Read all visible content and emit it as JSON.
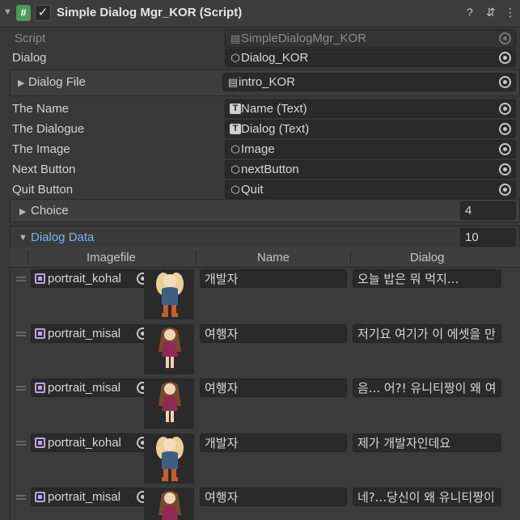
{
  "header": {
    "script_glyph": "#",
    "check_glyph": "✓",
    "title": "Simple Dialog Mgr_KOR (Script)",
    "help_glyph": "?",
    "settings_glyph": "⇵",
    "more_glyph": "⋮"
  },
  "script_row": {
    "label": "Script",
    "value": "SimpleDialogMgr_KOR",
    "icon": "script-file-icon"
  },
  "fields": [
    {
      "label": "Dialog",
      "value": "Dialog_KOR",
      "icon": "cube-icon",
      "glyph": "⬡"
    },
    {
      "label": "Dialog File",
      "value": "intro_KOR",
      "icon": "text-asset-icon",
      "glyph": "▤"
    },
    {
      "label": "The Name",
      "value": "Name (Text)",
      "icon": "text-component-icon",
      "glyph": "T"
    },
    {
      "label": "The Dialogue",
      "value": "Dialog (Text)",
      "icon": "text-component-icon",
      "glyph": "T"
    },
    {
      "label": "The Image",
      "value": "Image",
      "icon": "cube-icon",
      "glyph": "⬡"
    },
    {
      "label": "Next Button",
      "value": "nextButton",
      "icon": "cube-icon",
      "glyph": "⬡"
    },
    {
      "label": "Quit Button",
      "value": "Quit",
      "icon": "cube-icon",
      "glyph": "⬡"
    }
  ],
  "choice": {
    "label": "Choice",
    "count": "4"
  },
  "dialog_data": {
    "label": "Dialog Data",
    "count": "10",
    "columns": [
      "Imagefile",
      "Name",
      "Dialog"
    ],
    "rows": [
      {
        "image": "portrait_kohal",
        "name": "개발자",
        "dialog": "오늘 밥은 뭐 먹지...",
        "portrait": "kohal"
      },
      {
        "image": "portrait_misal",
        "name": "여행자",
        "dialog": "저기요 여기가 이 에셋을 만",
        "portrait": "misal"
      },
      {
        "image": "portrait_misal",
        "name": "여행자",
        "dialog": "음...  어?! 유니티짱이 왜 여",
        "portrait": "misal"
      },
      {
        "image": "portrait_kohal",
        "name": "개발자",
        "dialog": "제가 개발자인데요",
        "portrait": "kohal"
      },
      {
        "image": "portrait_misal",
        "name": "여행자",
        "dialog": "네?...당신이 왜 유니티짱이",
        "portrait": "misal"
      }
    ]
  },
  "colors": {
    "accent_blue": "#7cb3f0",
    "background": "#383838",
    "field": "#2a2a2a"
  }
}
